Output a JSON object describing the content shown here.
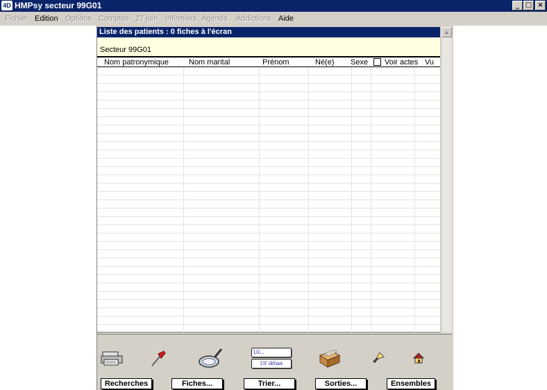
{
  "window": {
    "app_icon": "4D",
    "title": "HMPsy secteur 99G01",
    "controls": [
      "minimize-icon",
      "maximize-icon",
      "close-icon"
    ]
  },
  "menu": [
    {
      "label": "Fichier",
      "enabled": false
    },
    {
      "label": "Edition",
      "enabled": true
    },
    {
      "label": "Options",
      "enabled": false
    },
    {
      "label": "Comptes",
      "enabled": false
    },
    {
      "label": "27 juin",
      "enabled": false
    },
    {
      "label": "Infirmiers",
      "enabled": false
    },
    {
      "label": "Agenda",
      "enabled": false
    },
    {
      "label": "Addictions",
      "enabled": false
    },
    {
      "label": "Aide",
      "enabled": true
    }
  ],
  "list": {
    "title": "Liste des patients : 0 fiches à l'écran",
    "sector": "Secteur 99G01",
    "columns": [
      "Nom patronymique",
      "Nom marital",
      "Prénom",
      "Né(e)",
      "Sexe",
      "Voir actes",
      "Vu"
    ],
    "voir_actes_checked": false,
    "rows": []
  },
  "toolbar": {
    "icons": [
      "printer-icon",
      "pin-icon",
      "magnifier-icon",
      "file-box-icon",
      "brush-icon",
      "home-icon"
    ],
    "uf_label": "UF...",
    "uf_default_label": "UF défaut",
    "buttons": {
      "recherches": "Recherches",
      "fiches": "Fiches...",
      "trier": "Trier...",
      "sorties": "Sorties...",
      "ensembles": "Ensembles"
    }
  },
  "colors": {
    "titlebar": "#0a246a",
    "sector_background": "#ffffe1",
    "chrome": "#d4d0c8"
  }
}
